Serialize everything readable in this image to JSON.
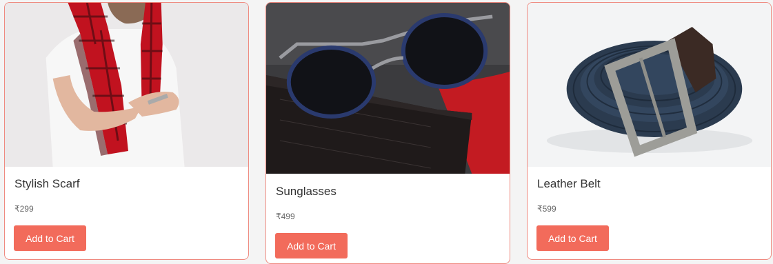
{
  "products": [
    {
      "name": "Stylish Scarf",
      "price": "₹299",
      "button": "Add to Cart",
      "image_icon": "scarf-photo-icon"
    },
    {
      "name": "Sunglasses",
      "price": "₹499",
      "button": "Add to Cart",
      "image_icon": "sunglasses-photo-icon"
    },
    {
      "name": "Leather Belt",
      "price": "₹599",
      "button": "Add to Cart",
      "image_icon": "belt-photo-icon"
    }
  ],
  "colors": {
    "accent": "#f26b5b",
    "card_border": "#ef8a80",
    "text": "#333333",
    "price_text": "#666666"
  }
}
